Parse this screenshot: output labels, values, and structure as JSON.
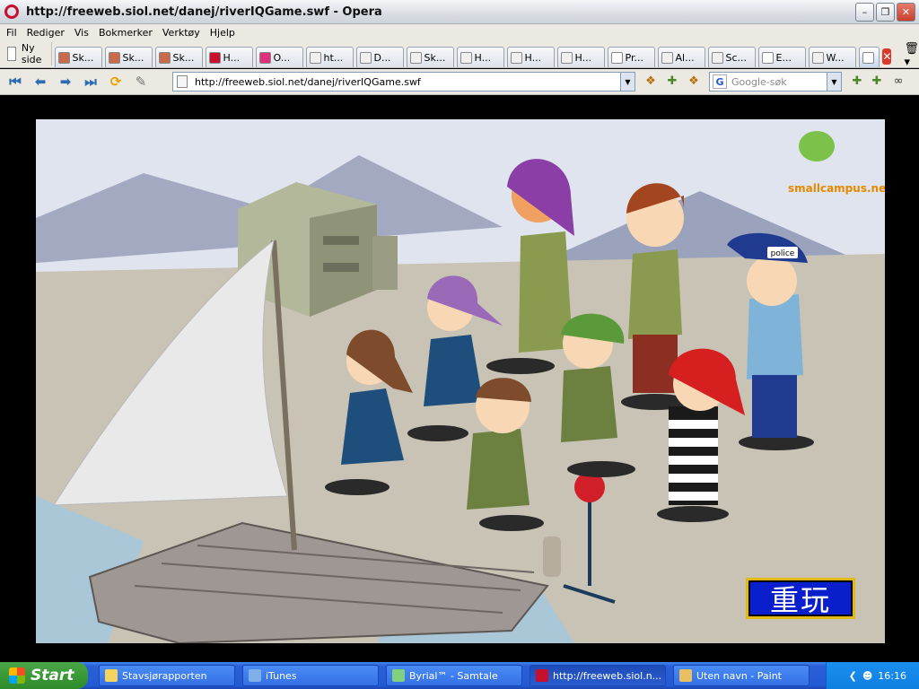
{
  "window": {
    "title": "http://freeweb.siol.net/danej/riverIQGame.swf - Opera"
  },
  "menu": [
    "Fil",
    "Rediger",
    "Vis",
    "Bokmerker",
    "Verktøy",
    "Hjelp"
  ],
  "tabs": {
    "new_page_label": "Ny side",
    "items": [
      {
        "label": "Sk...",
        "color": "#c96b4a"
      },
      {
        "label": "Sk...",
        "color": "#c96b4a"
      },
      {
        "label": "Sk...",
        "color": "#c96b4a"
      },
      {
        "label": "H...",
        "color": "#c8102e"
      },
      {
        "label": "O...",
        "color": "#e0307a"
      },
      {
        "label": "ht...",
        "color": "#f0f0f0"
      },
      {
        "label": "D...",
        "color": "#f0f0f0"
      },
      {
        "label": "Sk...",
        "color": "#f0f0f0"
      },
      {
        "label": "H...",
        "color": "#f0f0f0"
      },
      {
        "label": "H...",
        "color": "#f0f0f0"
      },
      {
        "label": "H...",
        "color": "#f0f0f0"
      },
      {
        "label": "Pr...",
        "color": "#ffffff"
      },
      {
        "label": "Al...",
        "color": "#f0f0f0"
      },
      {
        "label": "Sc...",
        "color": "#f0f0f0"
      },
      {
        "label": "E...",
        "color": "#ffffff"
      },
      {
        "label": "W...",
        "color": "#f0f0f0"
      }
    ]
  },
  "address": {
    "url": "http://freeweb.siol.net/danej/riverIQGame.swf"
  },
  "search": {
    "placeholder": "Google-søk"
  },
  "game": {
    "replay_label": "重玩",
    "logo_brand": "smallcampus.net",
    "police_cap": "police"
  },
  "taskbar": {
    "start_label": "Start",
    "tasks": [
      {
        "label": "Stavsjørapporten",
        "color": "#f4d35e"
      },
      {
        "label": "iTunes",
        "color": "#7fb0e8"
      },
      {
        "label": "Byrial™ - Samtale",
        "color": "#7fd07f"
      },
      {
        "label": "http://freeweb.siol.n...",
        "color": "#c8102e"
      },
      {
        "label": "Uten navn - Paint",
        "color": "#e8c060"
      }
    ],
    "clock": "16:16"
  }
}
